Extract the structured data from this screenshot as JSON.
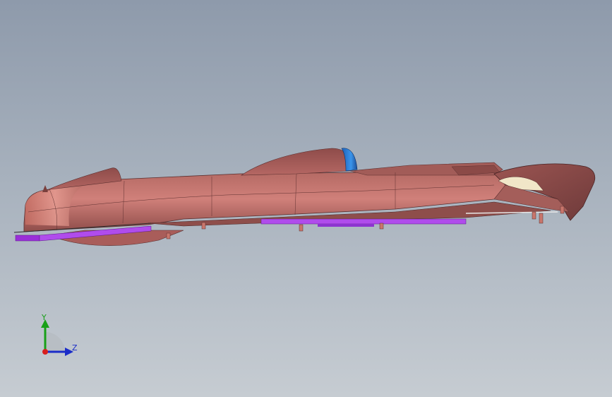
{
  "viewport": {
    "background_top": "#8e9aab",
    "background_bottom": "#c6ccd2",
    "model": {
      "body_color": "#c9766c",
      "canopy_color": "#2f7fd8",
      "trim_color": "#a840e6"
    }
  },
  "triad": {
    "y_label": "Y",
    "z_label": "Z",
    "y_color": "#18a018",
    "z_color": "#1a2cc8",
    "x_color": "#d81e1e"
  }
}
